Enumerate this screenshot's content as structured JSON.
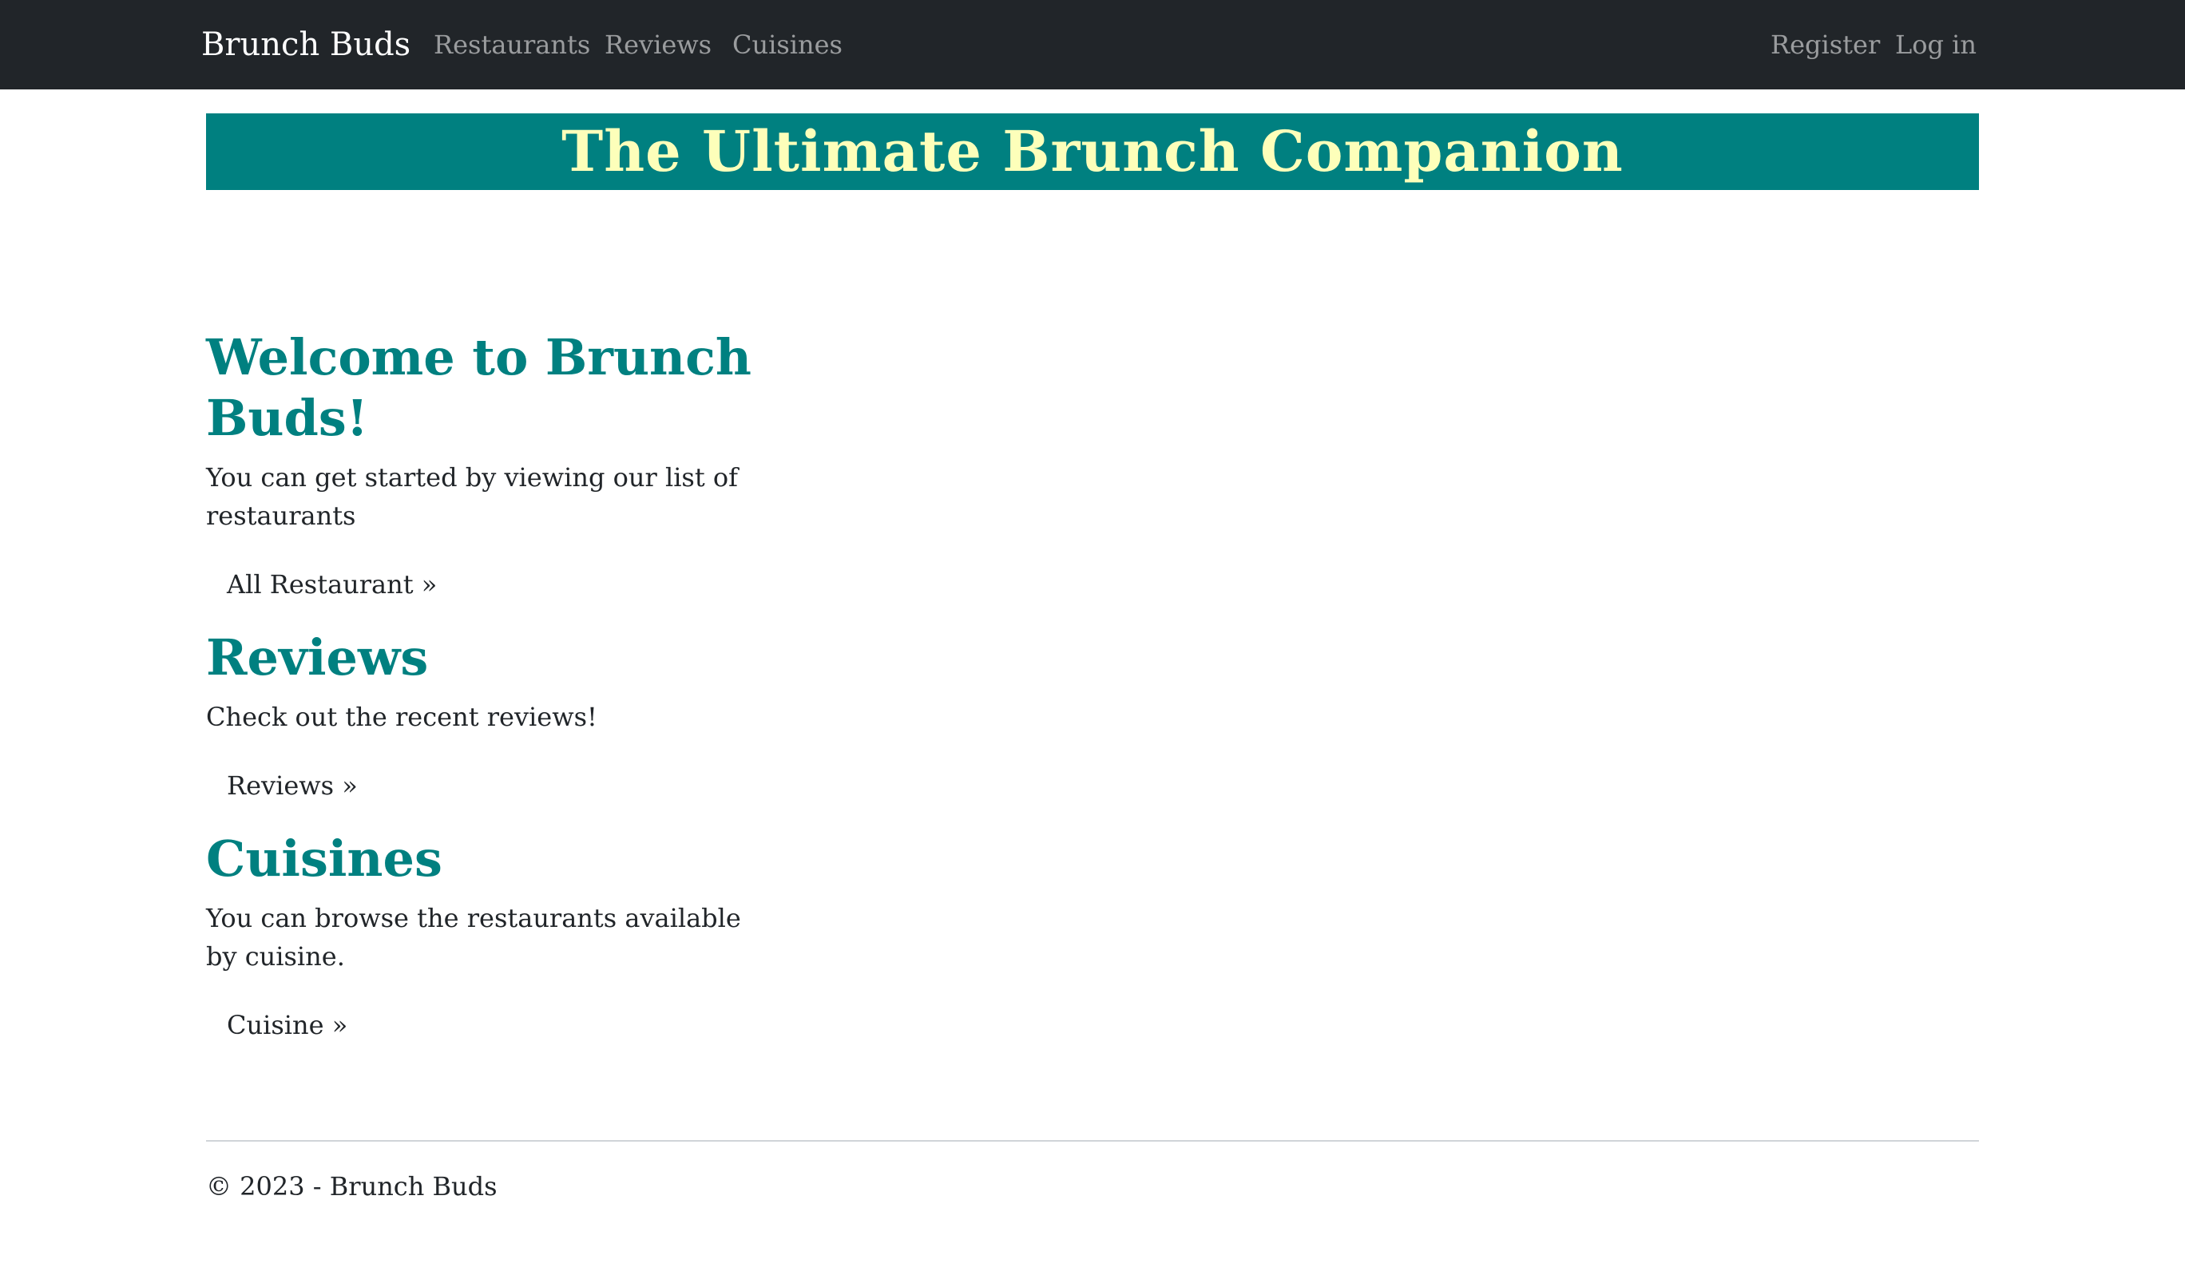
{
  "navbar": {
    "brand": "Brunch Buds",
    "links": [
      "Restaurants",
      "Reviews",
      "Cuisines"
    ],
    "right_links": [
      "Register",
      "Log in"
    ]
  },
  "banner": {
    "title": "The Ultimate Brunch Companion"
  },
  "sections": [
    {
      "title": "Welcome to Brunch Buds!",
      "text": "You can get started by viewing our list of restaurants",
      "link": "All Restaurant »"
    },
    {
      "title": "Reviews",
      "text": "Check out the recent reviews!",
      "link": "Reviews »"
    },
    {
      "title": "Cuisines",
      "text": "You can browse the restaurants available by cuisine.",
      "link": "Cuisine »"
    }
  ],
  "footer": {
    "text": "© 2023 - Brunch Buds"
  },
  "colors": {
    "navbar_bg": "#212529",
    "banner_bg": "#008080",
    "banner_text": "#fdffba",
    "heading": "#008080"
  }
}
